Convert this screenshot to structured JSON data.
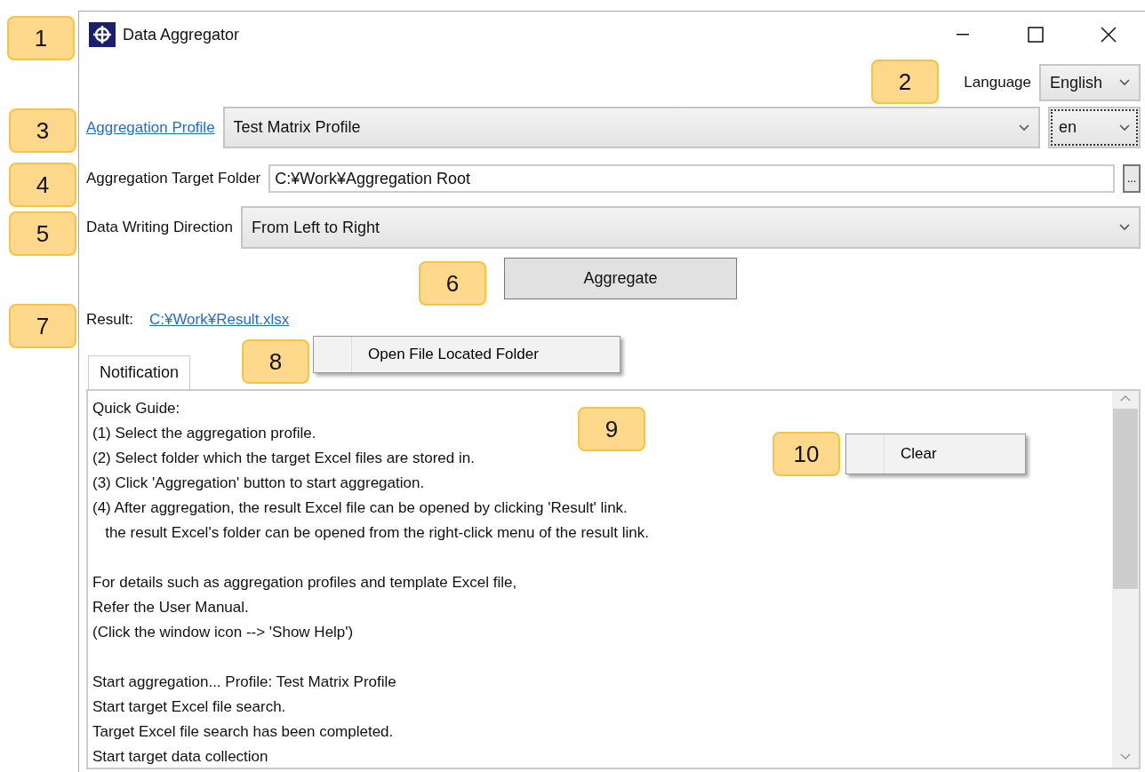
{
  "window": {
    "title": "Data Aggregator"
  },
  "language": {
    "label": "Language",
    "value": "English"
  },
  "profile": {
    "label": "Aggregation Profile",
    "value": "Test Matrix Profile",
    "locale": "en",
    "locale_focused": true
  },
  "target_folder": {
    "label": "Aggregation Target Folder",
    "value": "C:¥Work¥Aggregation Root",
    "browse": "..."
  },
  "direction": {
    "label": "Data Writing Direction",
    "value": "From Left to Right"
  },
  "aggregate_button": "Aggregate",
  "result": {
    "label": "Result:",
    "link": "C:¥Work¥Result.xlsx"
  },
  "tabs": [
    {
      "label": "Notification",
      "selected": true
    }
  ],
  "notification": {
    "paragraphs": [
      [
        "Quick Guide:",
        "(1) Select the aggregation profile.",
        "(2) Select folder which the target Excel files are stored in.",
        "(3) Click 'Aggregation' button to start aggregation.",
        "(4) After aggregation, the result Excel file can be opened by clicking 'Result' link.",
        "   the result Excel's folder can be opened from the right-click menu of the result link."
      ],
      [
        "For details such as aggregation profiles and template Excel file,",
        "Refer the User Manual.",
        "(Click the window icon --> 'Show Help')"
      ],
      [
        "Start aggregation... Profile: Test Matrix Profile",
        "Start target Excel file search.",
        "Target Excel file search has been completed.",
        "Start target data collection"
      ]
    ]
  },
  "context_menus": [
    {
      "item": "Open File Located Folder"
    },
    {
      "item": "Clear"
    }
  ],
  "callouts": [
    "1",
    "2",
    "3",
    "4",
    "5",
    "6",
    "7",
    "8",
    "9",
    "10"
  ]
}
